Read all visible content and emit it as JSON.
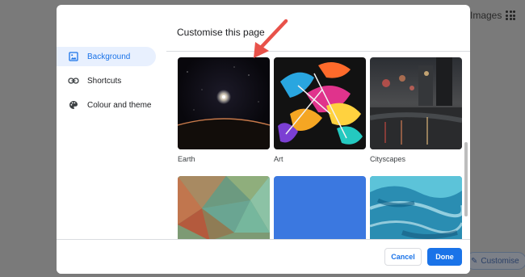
{
  "background_page": {
    "images_link": "Images",
    "customise_button": "Customise"
  },
  "dialog": {
    "title": "Customise this page",
    "sidebar": {
      "items": [
        {
          "label": "Background",
          "icon": "image-icon",
          "active": true
        },
        {
          "label": "Shortcuts",
          "icon": "link-icon",
          "active": false
        },
        {
          "label": "Colour and theme",
          "icon": "palette-icon",
          "active": false
        }
      ]
    },
    "collections": [
      {
        "label": "Earth"
      },
      {
        "label": "Art"
      },
      {
        "label": "Cityscapes"
      },
      {
        "label": ""
      },
      {
        "label": ""
      },
      {
        "label": ""
      }
    ],
    "footer": {
      "cancel_label": "Cancel",
      "done_label": "Done"
    }
  },
  "colors": {
    "accent": "#1a73e8",
    "annotation_arrow": "#e8524a",
    "active_item_bg": "#e8f0fe"
  }
}
